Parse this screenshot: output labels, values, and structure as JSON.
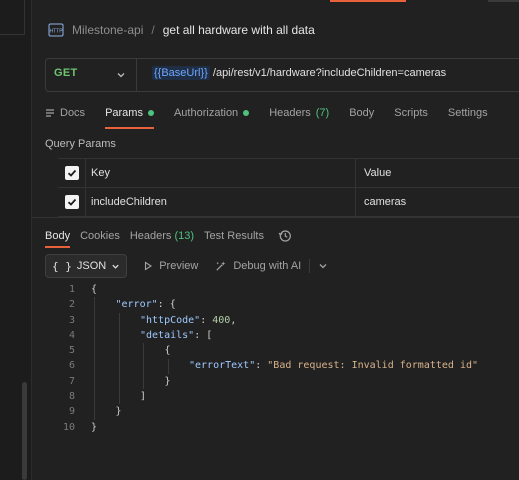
{
  "breadcrumb": {
    "parent": "Milestone-api",
    "separator": "/",
    "current": "get all hardware with all data"
  },
  "request": {
    "method": "GET",
    "url_variable": "{{BaseUrl}}",
    "url_path": "/api/rest/v1/hardware?includeChildren=cameras"
  },
  "request_tabs": [
    {
      "label": "Docs"
    },
    {
      "label": "Params",
      "active": true,
      "dot": true
    },
    {
      "label": "Authorization",
      "dot": true
    },
    {
      "label": "Headers",
      "count": "(7)"
    },
    {
      "label": "Body"
    },
    {
      "label": "Scripts"
    },
    {
      "label": "Settings"
    }
  ],
  "query_params": {
    "title": "Query Params",
    "headers": {
      "key": "Key",
      "value": "Value"
    },
    "rows": [
      {
        "key": "includeChildren",
        "value": "cameras",
        "checked": true
      }
    ]
  },
  "response_tabs": [
    {
      "label": "Body",
      "active": true
    },
    {
      "label": "Cookies"
    },
    {
      "label": "Headers",
      "count": "(13)"
    },
    {
      "label": "Test Results"
    }
  ],
  "response_toolbar": {
    "format": "JSON",
    "preview": "Preview",
    "debug": "Debug with AI"
  },
  "code_lines": [
    {
      "n": "1",
      "indent": 0,
      "tokens": [
        [
          "p",
          "{"
        ]
      ]
    },
    {
      "n": "2",
      "indent": 1,
      "tokens": [
        [
          "k",
          "\"error\""
        ],
        [
          "p",
          ": {"
        ]
      ]
    },
    {
      "n": "3",
      "indent": 2,
      "tokens": [
        [
          "k",
          "\"httpCode\""
        ],
        [
          "p",
          ": "
        ],
        [
          "n",
          "400"
        ],
        [
          "p",
          ","
        ]
      ]
    },
    {
      "n": "4",
      "indent": 2,
      "tokens": [
        [
          "k",
          "\"details\""
        ],
        [
          "p",
          ": ["
        ]
      ]
    },
    {
      "n": "5",
      "indent": 3,
      "tokens": [
        [
          "p",
          "{"
        ]
      ]
    },
    {
      "n": "6",
      "indent": 4,
      "tokens": [
        [
          "k",
          "\"errorText\""
        ],
        [
          "p",
          ": "
        ],
        [
          "s",
          "\"Bad request: Invalid formatted id\""
        ]
      ]
    },
    {
      "n": "7",
      "indent": 3,
      "tokens": [
        [
          "p",
          "}"
        ]
      ]
    },
    {
      "n": "8",
      "indent": 2,
      "tokens": [
        [
          "p",
          "]"
        ]
      ]
    },
    {
      "n": "9",
      "indent": 1,
      "tokens": [
        [
          "p",
          "}"
        ]
      ]
    },
    {
      "n": "10",
      "indent": 0,
      "tokens": [
        [
          "p",
          "}"
        ]
      ]
    }
  ],
  "colors": {
    "accent": "#e8603c",
    "method_get": "#6fc46f",
    "status_green": "#4ec27e",
    "variable": "#6fa8ff"
  }
}
